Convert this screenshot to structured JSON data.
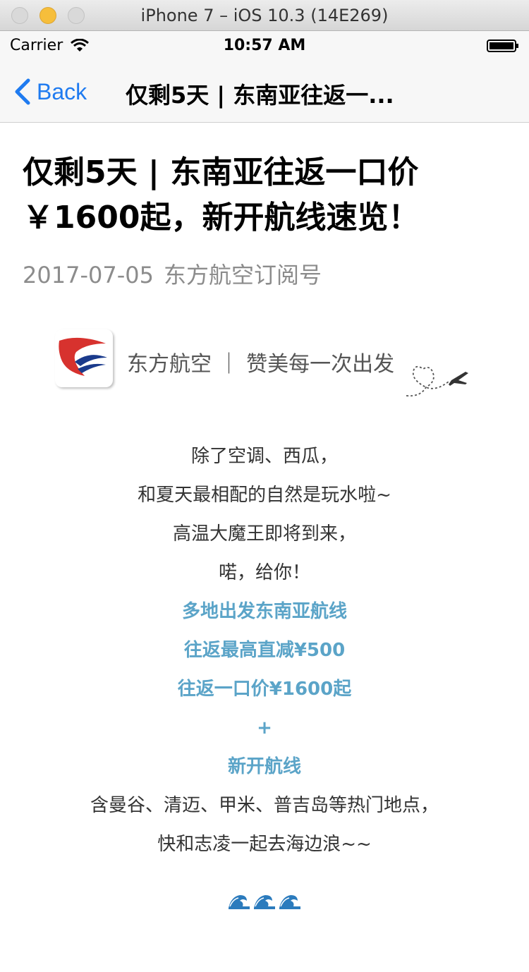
{
  "window": {
    "title": "iPhone 7 – iOS 10.3 (14E269)"
  },
  "status_bar": {
    "carrier": "Carrier",
    "time": "10:57 AM"
  },
  "nav": {
    "back_label": "Back",
    "title": "仅剩5天 | 东南亚往返一..."
  },
  "article": {
    "title": "仅剩5天 | 东南亚往返一口价 ￥1600起，新开航线速览！",
    "date": "2017-07-05",
    "author": "东方航空订阅号",
    "banner_text": "东方航空 ｜ 赞美每一次出发",
    "lines": [
      {
        "text": "除了空调、西瓜，",
        "highlight": false
      },
      {
        "text": "和夏天最相配的自然是玩水啦~",
        "highlight": false
      },
      {
        "text": "高温大魔王即将到来，",
        "highlight": false
      },
      {
        "text": "喏，给你！",
        "highlight": false
      },
      {
        "text": "多地出发东南亚航线",
        "highlight": true
      },
      {
        "text": "往返最高直减¥500",
        "highlight": true
      },
      {
        "text": "往返一口价¥1600起",
        "highlight": true
      },
      {
        "text": "+",
        "highlight": true
      },
      {
        "text": "新开航线",
        "highlight": true
      },
      {
        "text": "含曼谷、清迈、甲米、普吉岛等热门地点，",
        "highlight": false
      },
      {
        "text": "快和志凌一起去海边浪~~",
        "highlight": false
      }
    ],
    "wave_emoji_count": 3
  },
  "colors": {
    "ios_blue": "#1f7bf0",
    "highlight": "#5ba4c8",
    "meta_gray": "#8c8c8c",
    "logo_red": "#d7322e",
    "logo_blue": "#1a3a8c"
  },
  "icons": [
    "wifi-icon",
    "battery-icon",
    "back-chevron-icon",
    "china-eastern-logo-icon",
    "heart-plane-icon",
    "wave-icon"
  ]
}
